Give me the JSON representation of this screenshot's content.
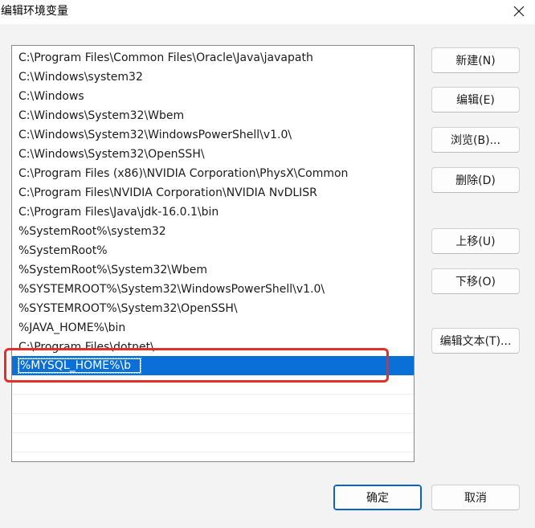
{
  "window": {
    "title": "编辑环境变量"
  },
  "path_list": {
    "items": [
      "C:\\Program Files\\Common Files\\Oracle\\Java\\javapath",
      "C:\\Windows\\system32",
      "C:\\Windows",
      "C:\\Windows\\System32\\Wbem",
      "C:\\Windows\\System32\\WindowsPowerShell\\v1.0\\",
      "C:\\Windows\\System32\\OpenSSH\\",
      "C:\\Program Files (x86)\\NVIDIA Corporation\\PhysX\\Common",
      "C:\\Program Files\\NVIDIA Corporation\\NVIDIA NvDLISR",
      "C:\\Program Files\\Java\\jdk-16.0.1\\bin",
      "%SystemRoot%\\system32",
      "%SystemRoot%",
      "%SystemRoot%\\System32\\Wbem",
      "%SYSTEMROOT%\\System32\\WindowsPowerShell\\v1.0\\",
      "%SYSTEMROOT%\\System32\\OpenSSH\\",
      "%JAVA_HOME%\\bin",
      "C:\\Program Files\\dotnet\\"
    ],
    "editing_value": "%MYSQL_HOME%\\bin"
  },
  "buttons": {
    "new": "新建(N)",
    "edit": "编辑(E)",
    "browse": "浏览(B)...",
    "delete": "删除(D)",
    "move_up": "上移(U)",
    "move_down": "下移(O)",
    "edit_text": "编辑文本(T)...",
    "ok": "确定",
    "cancel": "取消"
  },
  "colors": {
    "selection": "#0a6fd6",
    "annotation": "#e0302a",
    "primary_border": "#0a62c9"
  },
  "icons": {
    "close": "close-icon"
  }
}
